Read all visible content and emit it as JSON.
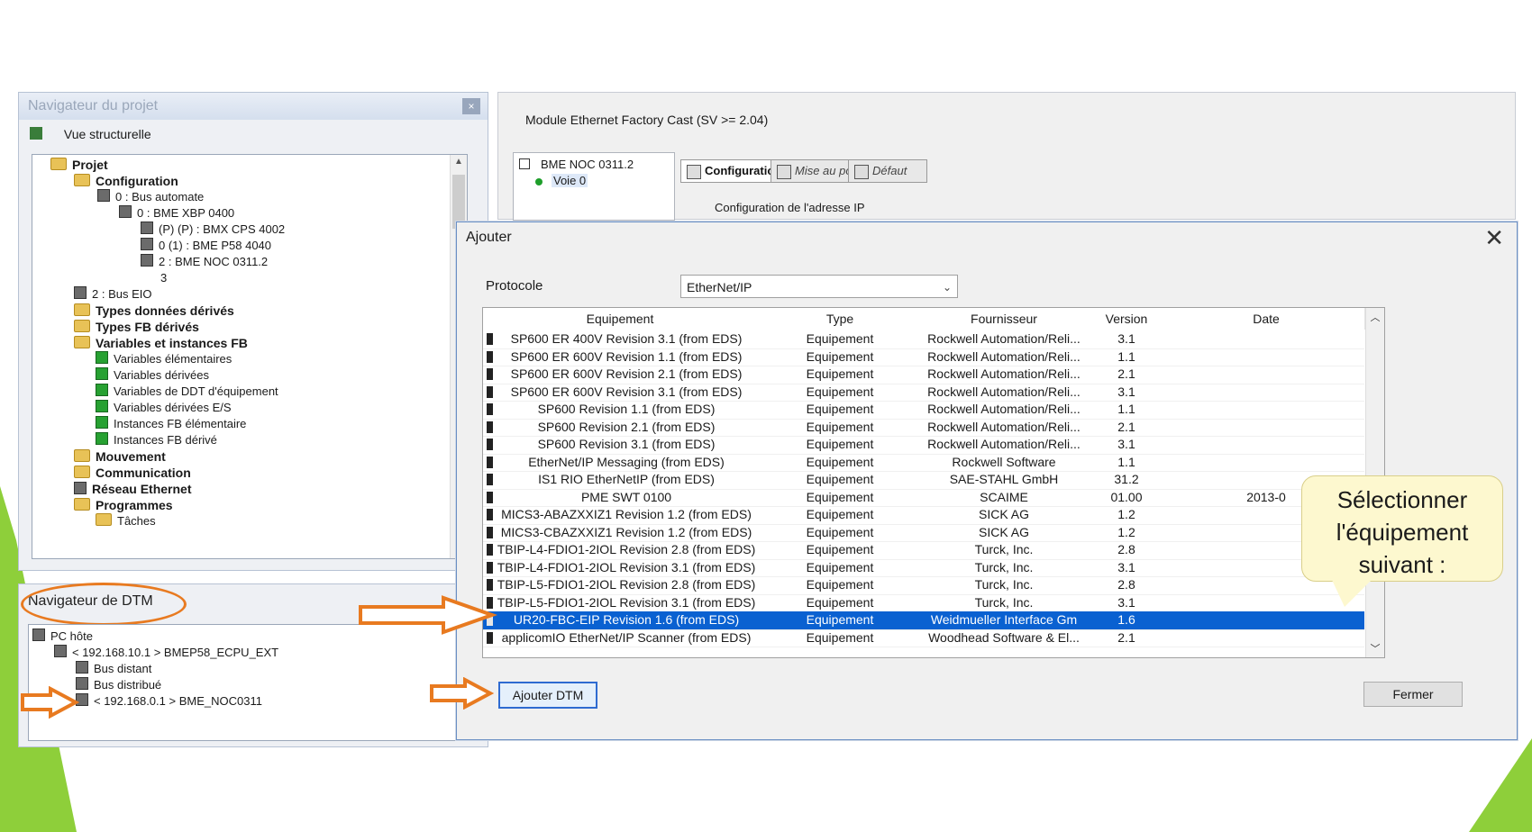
{
  "project_nav": {
    "title": "Navigateur du projet",
    "close": "×",
    "view_label": "Vue structurelle",
    "tree": [
      {
        "label": "Projet",
        "bold": true,
        "icon": "folder-icon"
      },
      {
        "label": "Configuration",
        "bold": true,
        "icon": "folder-icon"
      },
      {
        "label": "0 : Bus automate",
        "bold": false,
        "icon": "bus-icon"
      },
      {
        "label": "0 : BME XBP 0400",
        "bold": false,
        "icon": "rack-icon"
      },
      {
        "label": "(P) (P) : BMX CPS 4002",
        "bold": false,
        "icon": "module-icon"
      },
      {
        "label": "0 (1) : BME P58 4040",
        "bold": false,
        "icon": "module-icon"
      },
      {
        "label": "2 : BME NOC 0311.2",
        "bold": false,
        "icon": "module-icon"
      },
      {
        "label": "3",
        "bold": false,
        "icon": "slot-icon"
      },
      {
        "label": "2 : Bus EIO",
        "bold": false,
        "icon": "bus-icon"
      },
      {
        "label": "Types données dérivés",
        "bold": true,
        "icon": "folder-icon"
      },
      {
        "label": "Types FB dérivés",
        "bold": true,
        "icon": "folder-icon"
      },
      {
        "label": "Variables et instances FB",
        "bold": true,
        "icon": "folder-icon"
      },
      {
        "label": "Variables élémentaires",
        "bold": false,
        "icon": "variable-icon"
      },
      {
        "label": "Variables dérivées",
        "bold": false,
        "icon": "variable-icon"
      },
      {
        "label": "Variables de DDT d'équipement",
        "bold": false,
        "icon": "variable-icon"
      },
      {
        "label": "Variables dérivées E/S",
        "bold": false,
        "icon": "variable-icon"
      },
      {
        "label": "Instances FB élémentaire",
        "bold": false,
        "icon": "variable-icon"
      },
      {
        "label": "Instances FB dérivé",
        "bold": false,
        "icon": "variable-icon"
      },
      {
        "label": "Mouvement",
        "bold": true,
        "icon": "folder-icon"
      },
      {
        "label": "Communication",
        "bold": true,
        "icon": "folder-icon"
      },
      {
        "label": "Réseau Ethernet",
        "bold": true,
        "icon": "network-icon"
      },
      {
        "label": "Programmes",
        "bold": true,
        "icon": "folder-icon"
      },
      {
        "label": "Tâches",
        "bold": false,
        "icon": "folder-icon"
      }
    ]
  },
  "dtm_nav": {
    "title": "Navigateur de DTM",
    "tree": [
      {
        "label": "PC hôte"
      },
      {
        "label": "< 192.168.10.1 > BMEP58_ECPU_EXT"
      },
      {
        "label": "Bus distant"
      },
      {
        "label": "Bus distribué"
      },
      {
        "label": "< 192.168.0.1 > BME_NOC0311"
      }
    ]
  },
  "module": {
    "title": "Module Ethernet Factory Cast (SV >= 2.04)",
    "tree": [
      "BME NOC 0311.2",
      "Voie 0"
    ],
    "tabs": [
      "Configuration",
      "Mise au point",
      "Défaut"
    ],
    "config_label": "Configuration de l'adresse IP"
  },
  "dialog": {
    "title": "Ajouter",
    "close": "✕",
    "protocol_label": "Protocole",
    "protocol_value": "EtherNet/IP",
    "columns": [
      "Equipement",
      "Type",
      "Fournisseur",
      "Version",
      "Date"
    ],
    "rows": [
      {
        "name": "SP600 ER 400V Revision 3.1 (from EDS)",
        "type": "Equipement",
        "vendor": "Rockwell Automation/Reli...",
        "version": "3.1",
        "date": ""
      },
      {
        "name": "SP600 ER 600V Revision 1.1 (from EDS)",
        "type": "Equipement",
        "vendor": "Rockwell Automation/Reli...",
        "version": "1.1",
        "date": ""
      },
      {
        "name": "SP600 ER 600V Revision 2.1 (from EDS)",
        "type": "Equipement",
        "vendor": "Rockwell Automation/Reli...",
        "version": "2.1",
        "date": ""
      },
      {
        "name": "SP600 ER 600V Revision 3.1 (from EDS)",
        "type": "Equipement",
        "vendor": "Rockwell Automation/Reli...",
        "version": "3.1",
        "date": ""
      },
      {
        "name": "SP600 Revision 1.1 (from EDS)",
        "type": "Equipement",
        "vendor": "Rockwell Automation/Reli...",
        "version": "1.1",
        "date": ""
      },
      {
        "name": "SP600 Revision 2.1 (from EDS)",
        "type": "Equipement",
        "vendor": "Rockwell Automation/Reli...",
        "version": "2.1",
        "date": ""
      },
      {
        "name": "SP600 Revision 3.1 (from EDS)",
        "type": "Equipement",
        "vendor": "Rockwell Automation/Reli...",
        "version": "3.1",
        "date": ""
      },
      {
        "name": "EtherNet/IP Messaging (from EDS)",
        "type": "Equipement",
        "vendor": "Rockwell Software",
        "version": "1.1",
        "date": ""
      },
      {
        "name": "IS1 RIO EtherNetIP (from EDS)",
        "type": "Equipement",
        "vendor": "SAE-STAHL GmbH",
        "version": "31.2",
        "date": ""
      },
      {
        "name": "PME SWT 0100",
        "type": "Equipement",
        "vendor": "SCAIME",
        "version": "01.00",
        "date": "2013-0"
      },
      {
        "name": "MICS3-ABAZXXIZ1 Revision 1.2 (from EDS)",
        "type": "Equipement",
        "vendor": "SICK AG",
        "version": "1.2",
        "date": ""
      },
      {
        "name": "MICS3-CBAZXXIZ1 Revision 1.2 (from EDS)",
        "type": "Equipement",
        "vendor": "SICK AG",
        "version": "1.2",
        "date": ""
      },
      {
        "name": "TBIP-L4-FDIO1-2IOL Revision 2.8 (from EDS)",
        "type": "Equipement",
        "vendor": "Turck, Inc.",
        "version": "2.8",
        "date": ""
      },
      {
        "name": "TBIP-L4-FDIO1-2IOL Revision 3.1 (from EDS)",
        "type": "Equipement",
        "vendor": "Turck, Inc.",
        "version": "3.1",
        "date": ""
      },
      {
        "name": "TBIP-L5-FDIO1-2IOL Revision 2.8 (from EDS)",
        "type": "Equipement",
        "vendor": "Turck, Inc.",
        "version": "2.8",
        "date": ""
      },
      {
        "name": "TBIP-L5-FDIO1-2IOL Revision 3.1 (from EDS)",
        "type": "Equipement",
        "vendor": "Turck, Inc.",
        "version": "3.1",
        "date": ""
      },
      {
        "name": "UR20-FBC-EIP Revision 1.6 (from EDS)",
        "type": "Equipement",
        "vendor": "Weidmueller Interface Gm",
        "version": "1.6",
        "date": "",
        "selected": true
      },
      {
        "name": "applicomIO EtherNet/IP Scanner (from EDS)",
        "type": "Equipement",
        "vendor": "Woodhead Software & El...",
        "version": "2.1",
        "date": ""
      }
    ],
    "add_button": "Ajouter DTM",
    "close_button": "Fermer"
  },
  "callout": {
    "text_lines": [
      "Sélectionner",
      "l'équipement",
      "suivant :"
    ]
  },
  "colors": {
    "selection": "#0a61d1",
    "arrow": "#e87a20",
    "callout_bg": "#fdf8cf",
    "slide_green": "#8ecf3a"
  }
}
